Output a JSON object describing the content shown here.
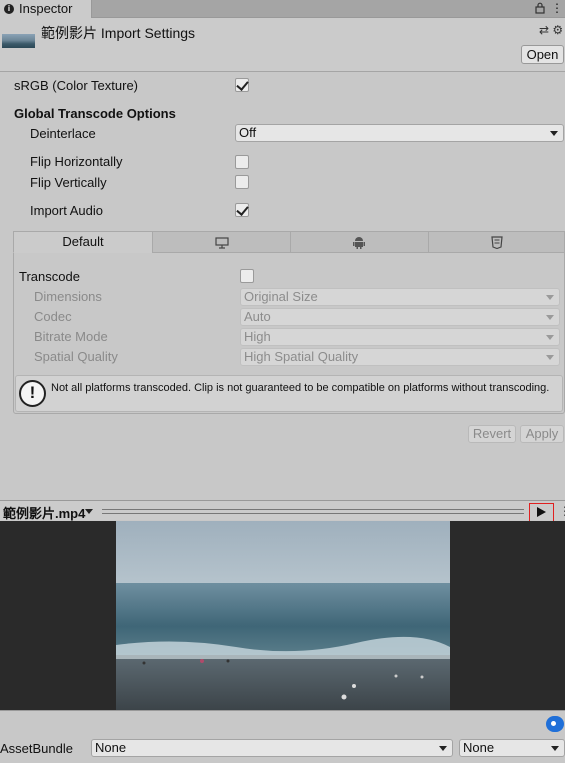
{
  "tab": {
    "label": "Inspector"
  },
  "header": {
    "title": "範例影片 Import Settings",
    "open_label": "Open"
  },
  "rows": {
    "srgb": {
      "label": "sRGB (Color Texture)",
      "checked": true
    },
    "global_heading": "Global Transcode Options",
    "deinterlace": {
      "label": "Deinterlace",
      "value": "Off"
    },
    "flip_h": {
      "label": "Flip Horizontally",
      "checked": false
    },
    "flip_v": {
      "label": "Flip Vertically",
      "checked": false
    },
    "import_audio": {
      "label": "Import Audio",
      "checked": true
    }
  },
  "platform_tabs": [
    {
      "label": "Default",
      "icon": ""
    },
    {
      "label": "",
      "icon": "monitor-icon"
    },
    {
      "label": "",
      "icon": "android-icon"
    },
    {
      "label": "",
      "icon": "html5-icon"
    }
  ],
  "transcode": {
    "label": "Transcode",
    "checked": false,
    "dimensions": {
      "label": "Dimensions",
      "value": "Original Size"
    },
    "codec": {
      "label": "Codec",
      "value": "Auto"
    },
    "bitrate": {
      "label": "Bitrate Mode",
      "value": "High"
    },
    "spatial": {
      "label": "Spatial Quality",
      "value": "High Spatial Quality"
    }
  },
  "warning": {
    "text": "Not all platforms transcoded. Clip is not guaranteed to be compatible on platforms without transcoding."
  },
  "actions": {
    "revert": "Revert",
    "apply": "Apply"
  },
  "preview": {
    "title": "範例影片.mp4"
  },
  "bottom": {
    "assetbundle_label": "AssetBundle",
    "bundle_value": "None",
    "variant_value": "None"
  }
}
